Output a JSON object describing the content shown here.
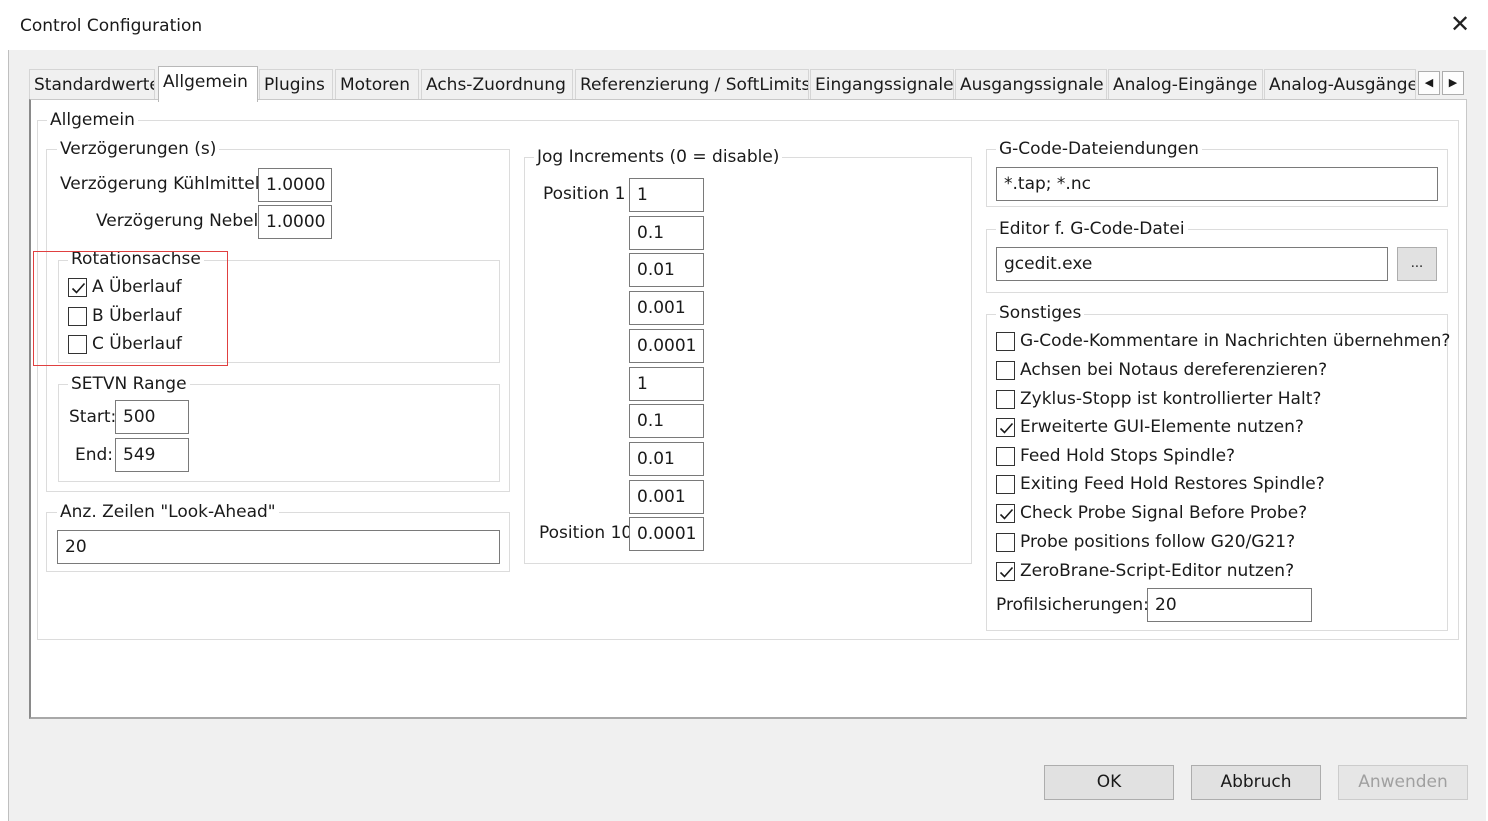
{
  "window": {
    "title": "Control Configuration"
  },
  "tabs": [
    {
      "label": "Standardwerte",
      "active": false
    },
    {
      "label": "Allgemein",
      "active": true
    },
    {
      "label": "Plugins",
      "active": false
    },
    {
      "label": "Motoren",
      "active": false
    },
    {
      "label": "Achs-Zuordnung",
      "active": false
    },
    {
      "label": "Referenzierung / SoftLimits",
      "active": false
    },
    {
      "label": "Eingangssignale",
      "active": false
    },
    {
      "label": "Ausgangssignale",
      "active": false
    },
    {
      "label": "Analog-Eingänge",
      "active": false
    },
    {
      "label": "Analog-Ausgänge",
      "active": false
    }
  ],
  "allgemein": {
    "group_title": "Allgemein",
    "delays": {
      "title": "Verzögerungen (s)",
      "coolant_label": "Verzögerung Kühlmittel:",
      "coolant_value": "1.0000",
      "mist_label": "Verzögerung Nebel:",
      "mist_value": "1.0000"
    },
    "rotation": {
      "title": "Rotationsachse",
      "a": {
        "label": "A Überlauf",
        "checked": true
      },
      "b": {
        "label": "B Überlauf",
        "checked": false
      },
      "c": {
        "label": "C Überlauf",
        "checked": false
      }
    },
    "setvn": {
      "title": "SETVN Range",
      "start_label": "Start:",
      "start_value": "500",
      "end_label": "End:",
      "end_value": "549"
    },
    "lookahead": {
      "title": "Anz. Zeilen \"Look-Ahead\"",
      "value": "20"
    }
  },
  "jog": {
    "title": "Jog Increments (0 = disable)",
    "first_label": "Position 1",
    "last_label": "Position 10",
    "values": [
      "1",
      "0.1",
      "0.01",
      "0.001",
      "0.0001",
      "1",
      "0.1",
      "0.01",
      "0.001",
      "0.0001"
    ]
  },
  "gcode_ext": {
    "title": "G-Code-Dateiendungen",
    "value": "*.tap; *.nc"
  },
  "editor": {
    "title": "Editor f. G-Code-Datei",
    "value": "gcedit.exe",
    "browse_label": "..."
  },
  "misc": {
    "title": "Sonstiges",
    "options": [
      {
        "label": "G-Code-Kommentare in Nachrichten übernehmen?",
        "checked": false
      },
      {
        "label": "Achsen bei Notaus dereferenzieren?",
        "checked": false
      },
      {
        "label": "Zyklus-Stopp ist kontrollierter Halt?",
        "checked": false
      },
      {
        "label": "Erweiterte GUI-Elemente nutzen?",
        "checked": true
      },
      {
        "label": "Feed Hold Stops Spindle?",
        "checked": false
      },
      {
        "label": "Exiting Feed Hold Restores Spindle?",
        "checked": false
      },
      {
        "label": "Check Probe Signal Before Probe?",
        "checked": true
      },
      {
        "label": "Probe positions follow G20/G21?",
        "checked": false
      },
      {
        "label": "ZeroBrane-Script-Editor nutzen?",
        "checked": true
      }
    ],
    "profile_label": "Profilsicherungen:",
    "profile_value": "20"
  },
  "buttons": {
    "ok": "OK",
    "cancel": "Abbruch",
    "apply": "Anwenden"
  },
  "icons": {
    "close": "close-icon",
    "scroll_left": "chevron-left-icon",
    "scroll_right": "chevron-right-icon",
    "check": "checkmark-icon"
  },
  "colors": {
    "highlight_box": "#e04040",
    "dialog_background": "#f0f0f0"
  }
}
